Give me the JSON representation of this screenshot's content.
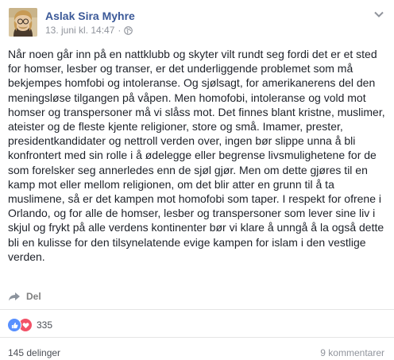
{
  "post": {
    "author": "Aslak Sira Myhre",
    "timestamp": "13. juni kl. 14:47",
    "meta_separator": "·",
    "privacy_icon": "globe-icon",
    "menu_icon": "chevron-down-icon",
    "body": "Når noen går inn på en nattklubb og skyter vilt rundt seg fordi det er et sted\nfor homser, lesber og transer, er det underliggende problemet som må\nbekjempes homfobi og intoleranse. Og sjølsagt, for amerikanerens del den\nmeningsløse tilgangen på våpen. Men homofobi, intoleranse og vold mot\nhomser og transpersoner må vi slåss mot. Det finnes blant kristne, muslimer,\nateister og de fleste kjente religioner, store og små. Imamer, prester,\npresidentkandidater og nettroll verden over, ingen bør slippe unna å bli\nkonfrontert med sin rolle i å ødelegge eller begrense livsmulighetene for de\nsom forelsker seg annerledes enn de sjøl gjør. Men om dette gjøres til en\nkamp mot eller mellom religionen, om det blir atter en grunn til å ta\nmuslimene, så er det kampen mot homofobi som taper. I respekt for ofrene i\nOrlando, og for alle de homser, lesber og transpersoner som lever sine liv i\nskjul og frykt på alle verdens kontinenter bør vi klare å unngå å la også dette\nbli en kulisse for den tilsynelatende evige kampen for islam i den vestlige\nverden."
  },
  "actions": {
    "share_label": "Del",
    "share_icon": "share-arrow-icon"
  },
  "reactions": {
    "count": "335",
    "icons": [
      "like-icon",
      "love-icon"
    ],
    "like_color": "#5890ff",
    "love_color": "#f25268"
  },
  "footer": {
    "shares": "145 delinger",
    "comments": "9 kommentarer"
  },
  "colors": {
    "name_blue": "#3b5998",
    "meta_gray": "#90949c",
    "text": "#1d2129"
  }
}
